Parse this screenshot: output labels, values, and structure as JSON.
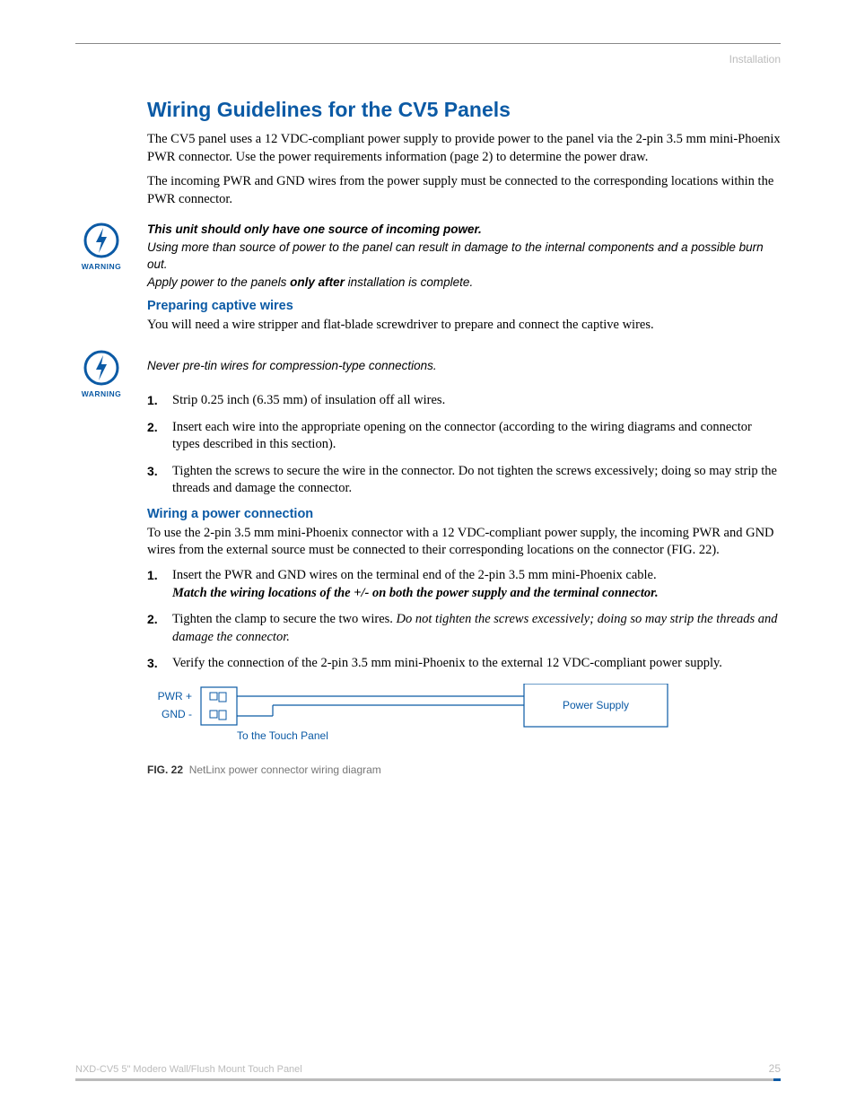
{
  "header": {
    "section": "Installation"
  },
  "title": "Wiring Guidelines for the CV5 Panels",
  "intro": {
    "p1": "The CV5 panel uses a 12 VDC-compliant power supply to provide power to the panel via the 2-pin 3.5 mm mini-Phoenix PWR connector. Use the power requirements information (page 2) to determine the power draw.",
    "p2": "The incoming PWR and GND wires from the power supply must be connected to the corresponding locations within the PWR connector."
  },
  "warning1": {
    "label": "WARNING",
    "bold": "This unit should only have one source of incoming power.",
    "line1": "Using more than source of power to the panel can result in damage to the internal components and a possible burn out.",
    "line2a": "Apply power to the panels ",
    "line2b": "only after",
    "line2c": " installation is complete."
  },
  "section1": {
    "heading": "Preparing captive wires",
    "body": "You will need a wire stripper and flat-blade screwdriver to prepare and connect the captive wires."
  },
  "warning2": {
    "label": "WARNING",
    "text": "Never pre-tin wires for compression-type connections."
  },
  "list1": {
    "i1": "Strip 0.25 inch (6.35 mm) of insulation off all wires.",
    "i2": "Insert each wire into the appropriate opening on the connector (according to the wiring diagrams and connector types described in this section).",
    "i3": "Tighten the screws to secure the wire in the connector. Do not tighten the screws excessively; doing so may strip the threads and damage the connector."
  },
  "section2": {
    "heading": "Wiring a power connection",
    "body": "To use the 2-pin 3.5 mm mini-Phoenix connector with a 12 VDC-compliant power supply, the incoming PWR and GND wires from the external source must be connected to their corresponding locations on the connector (FIG. 22)."
  },
  "list2": {
    "i1a": "Insert the PWR and GND wires on the terminal end of the 2-pin 3.5 mm mini-Phoenix cable.",
    "i1b": "Match the wiring locations of the +/- on both the power supply and the terminal connector.",
    "i2a": "Tighten the clamp to secure the two wires. ",
    "i2b": "Do not tighten the screws excessively; doing so may strip the threads and damage the connector.",
    "i3": "Verify the connection of the 2-pin 3.5 mm mini-Phoenix to the external 12 VDC-compliant power supply."
  },
  "diagram": {
    "pwr": "PWR +",
    "gnd": "GND -",
    "touch": "To the Touch Panel",
    "psu": "Power Supply"
  },
  "figure": {
    "label": "FIG. 22",
    "caption": "NetLinx power connector wiring diagram"
  },
  "footer": {
    "left": "NXD-CV5 5\" Modero Wall/Flush Mount Touch Panel",
    "page": "25"
  }
}
